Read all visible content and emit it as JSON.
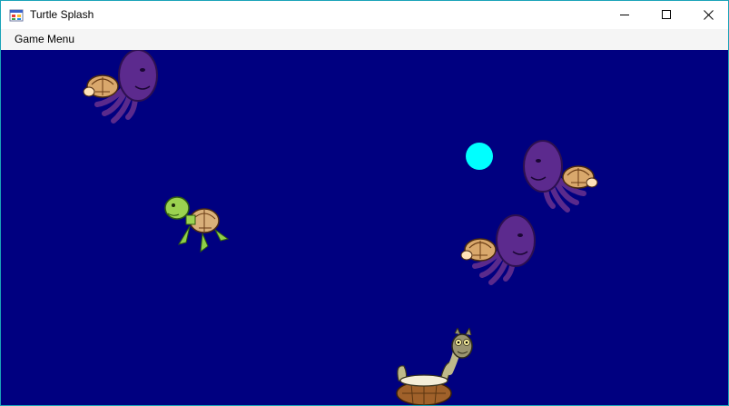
{
  "window": {
    "title": "Turtle Splash",
    "controls": [
      "minimize-icon",
      "maximize-icon",
      "close-icon"
    ]
  },
  "menu": {
    "items": [
      {
        "label": "Game Menu"
      }
    ]
  },
  "game": {
    "background_color": "#000080",
    "ball_color": "#00ffff",
    "sprites": [
      "octopus-carrying-turtle",
      "octopus-carrying-turtle",
      "octopus-carrying-turtle",
      "green-sea-turtle",
      "player-turtle-on-back",
      "cyan-ball"
    ]
  }
}
